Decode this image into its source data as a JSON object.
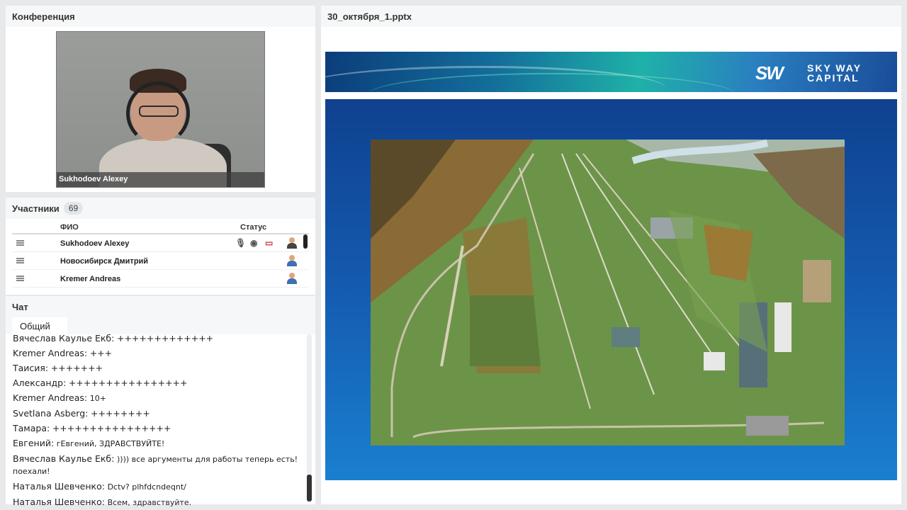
{
  "conference": {
    "title": "Конференция",
    "video_name": "Sukhodoev Alexey"
  },
  "participants": {
    "title": "Участники",
    "count": "69",
    "col_name": "ФИО",
    "col_status": "Статус",
    "rows": [
      {
        "name": "Sukhodoev Alexey"
      },
      {
        "name": "Новосибирск Дмитрий"
      },
      {
        "name": "Kremer Andreas"
      }
    ]
  },
  "chat": {
    "title": "Чат",
    "tab": "Общий",
    "messages": [
      {
        "author": "Вячеслав Каулье Екб:",
        "text": "+++++++++++++"
      },
      {
        "author": "Kremer Andreas:",
        "text": "+++"
      },
      {
        "author": "Таисия:",
        "text": "+++++++"
      },
      {
        "author": "Александр:",
        "text": "++++++++++++++++"
      },
      {
        "author": "Kremer Andreas:",
        "text": "10+"
      },
      {
        "author": "Svetlana Asberg:",
        "text": "++++++++"
      },
      {
        "author": "Тамара:",
        "text": "++++++++++++++++"
      },
      {
        "author": "Евгений:",
        "text": "гЕвгений, ЗДРАВСТВУЙТЕ!"
      },
      {
        "author": "Вячеслав Каулье Екб:",
        "text": ")))) все аргументы для работы теперь есть! поехали!"
      },
      {
        "author": "Наталья Шевченко:",
        "text": "Dctv? plhfdcndeqnt/"
      },
      {
        "author": "Наталья Шевченко:",
        "text": "Всем, здравствуйте."
      }
    ]
  },
  "presentation": {
    "title": "30_октября_1.pptx",
    "logo_mark": "SW",
    "logo_line1": "SKY WAY",
    "logo_line2": "CAPITAL"
  }
}
